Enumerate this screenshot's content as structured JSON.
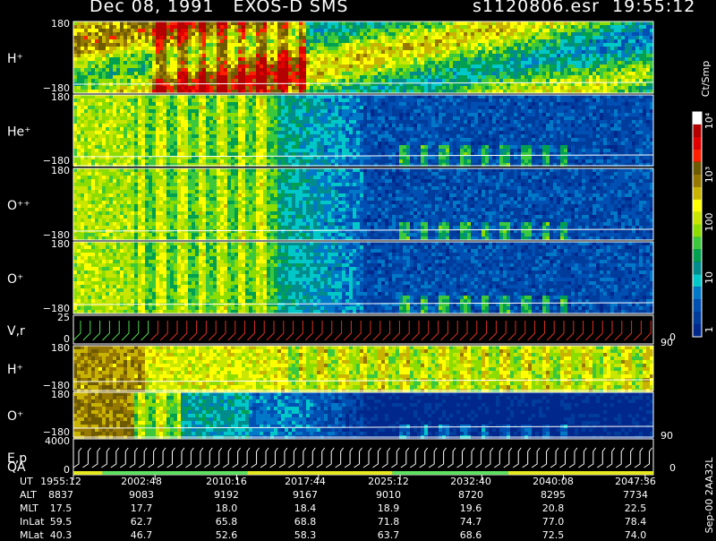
{
  "header": {
    "left_title": "Dec 08, 1991   EXOS-D SMS",
    "right_title": "s1120806.esr  19:55:12"
  },
  "colorbar": {
    "unit_label": "Ct/Smp",
    "tick_labels": [
      "10⁴",
      "10³",
      "100",
      "10",
      "1"
    ],
    "colors": [
      "#ffffff",
      "#b40000",
      "#e00000",
      "#ff2000",
      "#6e5a00",
      "#967800",
      "#c8b400",
      "#ffff00",
      "#c8e600",
      "#8cdc00",
      "#3cc83c",
      "#00a050",
      "#008c8c",
      "#00c8c8",
      "#0078c8",
      "#0050b4",
      "#003c9c",
      "#00288c"
    ]
  },
  "id_label": "Sep-00  2AA32L",
  "chart_data": {
    "type": "heatmap",
    "title": "Dec 08, 1991   EXOS-D SMS",
    "panels": [
      {
        "label": "H⁺",
        "ymax": "180",
        "ymin": "−180",
        "kind": "spectrogram"
      },
      {
        "label": "He⁺",
        "ymax": "180",
        "ymin": "−180",
        "kind": "spectrogram"
      },
      {
        "label": "O⁺⁺",
        "ymax": "180",
        "ymin": "−180",
        "kind": "spectrogram"
      },
      {
        "label": "O⁺",
        "ymax": "180",
        "ymin": "−180",
        "kind": "spectrogram"
      },
      {
        "label": "V,r",
        "ymax": "25",
        "ymin": "0",
        "right_tick": "90",
        "right_tick_low": "0",
        "kind": "line"
      },
      {
        "label": "H⁺",
        "ymax": "180",
        "ymin": "−180",
        "kind": "spectrogram"
      },
      {
        "label": "O⁺",
        "ymax": "180",
        "ymin": "−180",
        "right_tick": "90",
        "kind": "spectrogram"
      },
      {
        "label": "E,p",
        "label2": "QA",
        "ymax": "4000",
        "ymin": "0",
        "right_tick_low": "0",
        "kind": "sawtooth"
      }
    ],
    "ephemeris": {
      "labels": [
        "UT",
        "ALT",
        "MLT",
        "InLat",
        "MLat"
      ],
      "columns": [
        [
          "1955:12",
          "",
          "",
          "",
          ""
        ],
        [
          "2002:48",
          "9083",
          "17.7",
          "62.7",
          "46.7"
        ],
        [
          "2010:16",
          "9192",
          "18.0",
          "65.8",
          "52.6"
        ],
        [
          "2017:44",
          "9167",
          "18.4",
          "68.8",
          "58.3"
        ],
        [
          "2025:12",
          "9010",
          "18.9",
          "71.8",
          "63.7"
        ],
        [
          "2032:40",
          "8720",
          "19.6",
          "74.7",
          "68.6"
        ],
        [
          "2040:08",
          "8295",
          "20.8",
          "77.0",
          "72.5"
        ],
        [
          "2047:36",
          "7734",
          "22.5",
          "78.4",
          "74.0"
        ]
      ],
      "first_column": [
        "8837",
        "17.5",
        "59.5",
        "40.3"
      ]
    }
  }
}
